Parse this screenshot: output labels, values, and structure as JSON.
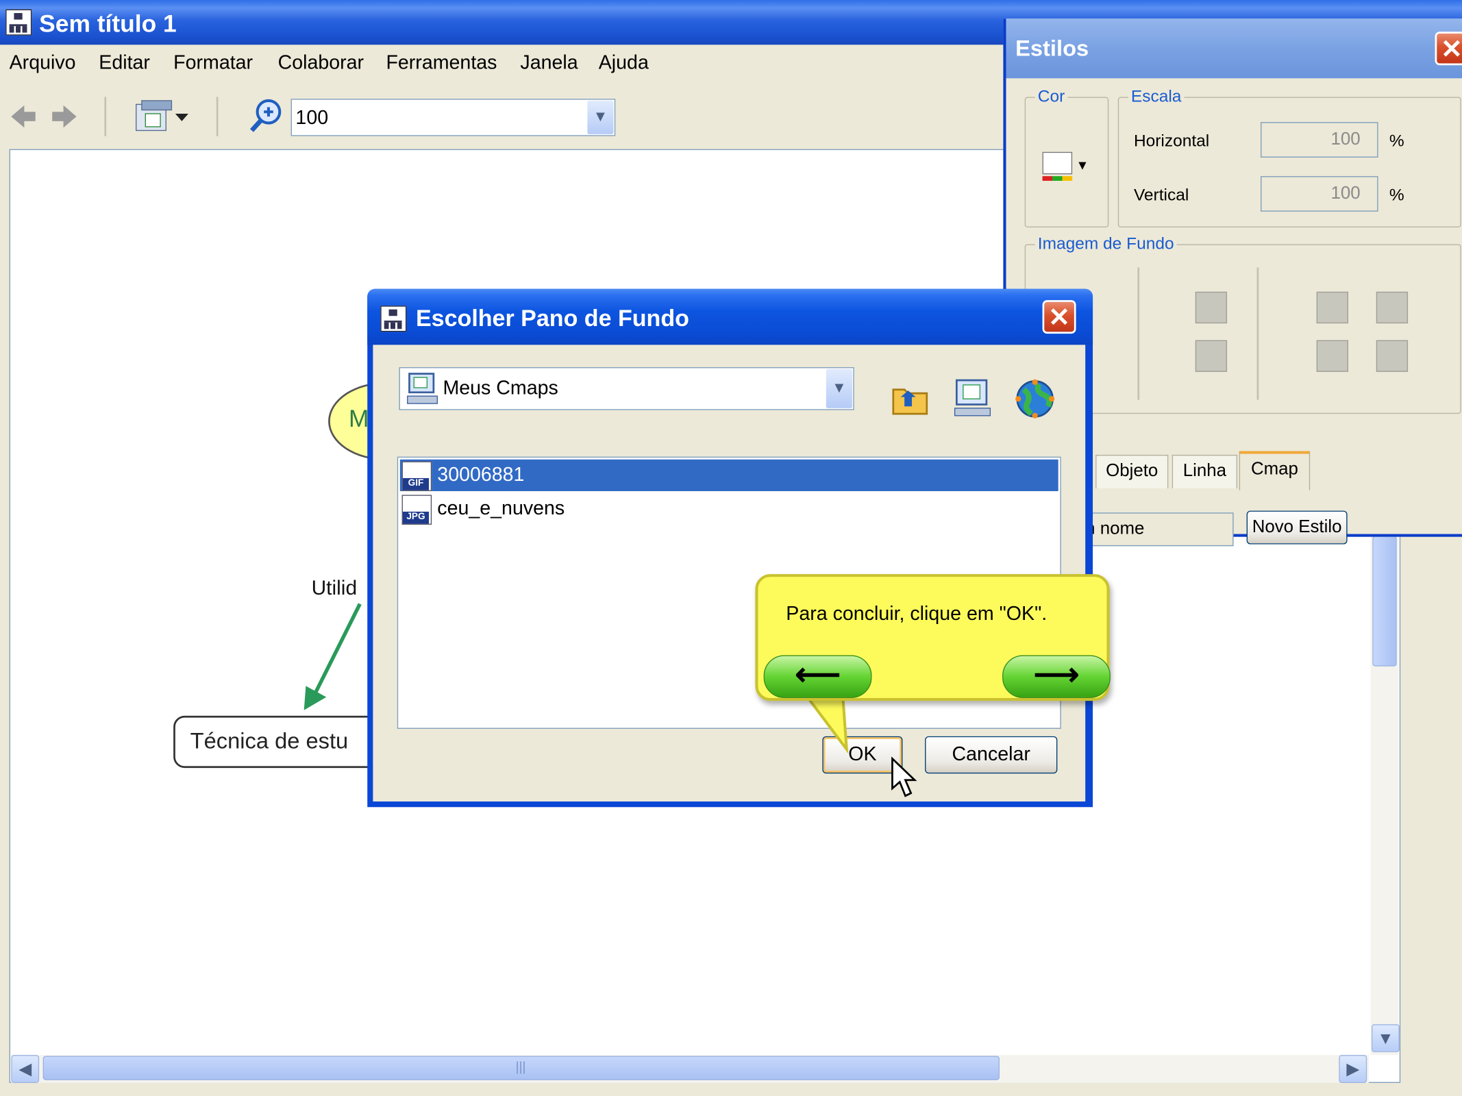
{
  "window": {
    "title": "Sem título 1"
  },
  "menubar": [
    "Arquivo",
    "Editar",
    "Formatar",
    "Colaborar",
    "Ferramentas",
    "Janela",
    "Ajuda"
  ],
  "toolbar": {
    "zoom_value": "100"
  },
  "concept_map": {
    "ellipse_letter": "M",
    "link_label": "Utilid",
    "rect_node": "Técnica de estu"
  },
  "styles_panel": {
    "title": "Estilos",
    "cor_label": "Cor",
    "escala_label": "Escala",
    "horizontal_label": "Horizontal",
    "horizontal_value": "100",
    "vertical_label": "Vertical",
    "vertical_value": "100",
    "percent": "%",
    "imagem_label": "Imagem de Fundo",
    "tabs": [
      "Objeto",
      "Linha",
      "Cmap"
    ],
    "active_tab": "Cmap",
    "name_field": "n nome",
    "new_style_button": "Novo Estilo"
  },
  "dialog": {
    "title": "Escolher Pano de Fundo",
    "location": "Meus Cmaps",
    "files": [
      {
        "name": "30006881",
        "type": "GIF",
        "selected": true
      },
      {
        "name": "ceu_e_nuvens",
        "type": "JPG",
        "selected": false
      }
    ],
    "ok_button": "OK",
    "cancel_button": "Cancelar"
  },
  "tooltip": {
    "text": "Para concluir, clique em \"OK\".",
    "back_arrow": "⟵",
    "next_arrow": "⟶"
  },
  "colors": {
    "title_blue": "#0a47d6",
    "selection": "#316ac5",
    "tooltip_yellow": "#fdfb5b",
    "nav_green": "#64d433",
    "arrow_green": "#2a9a5a"
  }
}
